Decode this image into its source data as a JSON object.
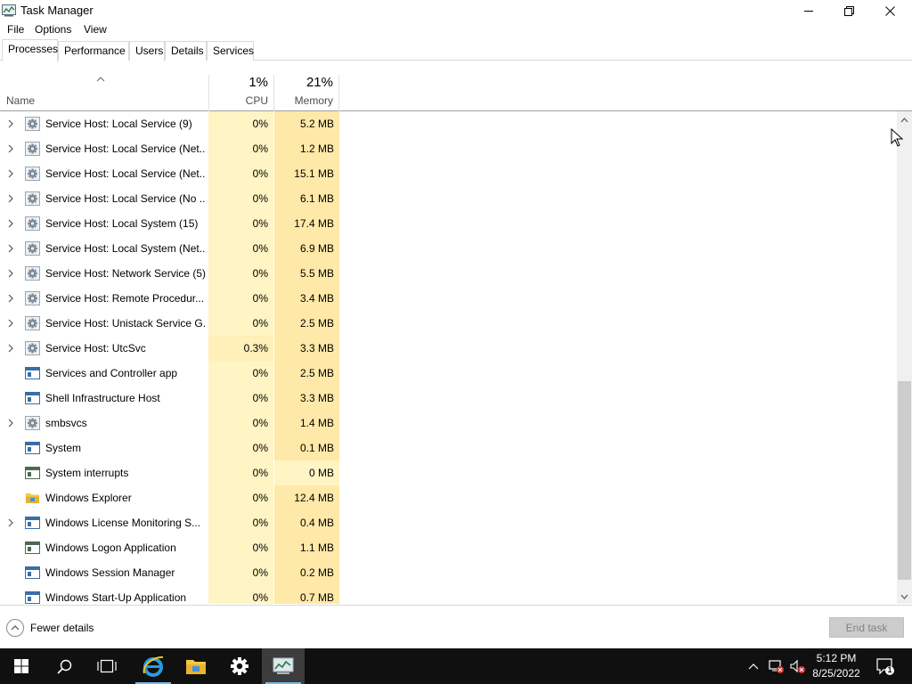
{
  "window": {
    "title": "Task Manager",
    "menu": [
      "File",
      "Options",
      "View"
    ],
    "tabs": [
      "Processes",
      "Performance",
      "Users",
      "Details",
      "Services"
    ],
    "active_tab": "Processes"
  },
  "columns": {
    "name_label": "Name",
    "cpu_percent": "1%",
    "cpu_label": "CPU",
    "memory_percent": "21%",
    "memory_label": "Memory"
  },
  "processes": [
    {
      "name": "Service Host: Local Service (9)",
      "cpu": "0%",
      "memory": "5.2 MB",
      "icon": "gear-icon",
      "expandable": true
    },
    {
      "name": "Service Host: Local Service (Net...",
      "cpu": "0%",
      "memory": "1.2 MB",
      "icon": "gear-icon",
      "expandable": true
    },
    {
      "name": "Service Host: Local Service (Net...",
      "cpu": "0%",
      "memory": "15.1 MB",
      "icon": "gear-icon",
      "expandable": true
    },
    {
      "name": "Service Host: Local Service (No ...",
      "cpu": "0%",
      "memory": "6.1 MB",
      "icon": "gear-icon",
      "expandable": true
    },
    {
      "name": "Service Host: Local System (15)",
      "cpu": "0%",
      "memory": "17.4 MB",
      "icon": "gear-icon",
      "expandable": true
    },
    {
      "name": "Service Host: Local System (Net...",
      "cpu": "0%",
      "memory": "6.9 MB",
      "icon": "gear-icon",
      "expandable": true
    },
    {
      "name": "Service Host: Network Service (5)",
      "cpu": "0%",
      "memory": "5.5 MB",
      "icon": "gear-icon",
      "expandable": true
    },
    {
      "name": "Service Host: Remote Procedur...",
      "cpu": "0%",
      "memory": "3.4 MB",
      "icon": "gear-icon",
      "expandable": true
    },
    {
      "name": "Service Host: Unistack Service G...",
      "cpu": "0%",
      "memory": "2.5 MB",
      "icon": "gear-icon",
      "expandable": true
    },
    {
      "name": "Service Host: UtcSvc",
      "cpu": "0.3%",
      "memory": "3.3 MB",
      "icon": "gear-icon",
      "expandable": true
    },
    {
      "name": "Services and Controller app",
      "cpu": "0%",
      "memory": "2.5 MB",
      "icon": "app-window-icon",
      "expandable": false
    },
    {
      "name": "Shell Infrastructure Host",
      "cpu": "0%",
      "memory": "3.3 MB",
      "icon": "app-window-icon",
      "expandable": false
    },
    {
      "name": "smbsvcs",
      "cpu": "0%",
      "memory": "1.4 MB",
      "icon": "gear-icon",
      "expandable": true
    },
    {
      "name": "System",
      "cpu": "0%",
      "memory": "0.1 MB",
      "icon": "app-window-icon",
      "expandable": false
    },
    {
      "name": "System interrupts",
      "cpu": "0%",
      "memory": "0 MB",
      "icon": "system-window-icon",
      "expandable": false
    },
    {
      "name": "Windows Explorer",
      "cpu": "0%",
      "memory": "12.4 MB",
      "icon": "folder-icon",
      "expandable": false
    },
    {
      "name": "Windows License Monitoring S...",
      "cpu": "0%",
      "memory": "0.4 MB",
      "icon": "app-window-icon",
      "expandable": true
    },
    {
      "name": "Windows Logon Application",
      "cpu": "0%",
      "memory": "1.1 MB",
      "icon": "system-window-icon",
      "expandable": false
    },
    {
      "name": "Windows Session Manager",
      "cpu": "0%",
      "memory": "0.2 MB",
      "icon": "app-window-icon",
      "expandable": false
    },
    {
      "name": "Windows Start-Up Application",
      "cpu": "0%",
      "memory": "0.7 MB",
      "icon": "app-window-icon",
      "expandable": false
    }
  ],
  "footer": {
    "fewer_details": "Fewer details",
    "end_task": "End task"
  },
  "taskbar": {
    "time": "5:12 PM",
    "date": "8/25/2022",
    "notification_count": "1",
    "accent": "#76b9ed"
  }
}
